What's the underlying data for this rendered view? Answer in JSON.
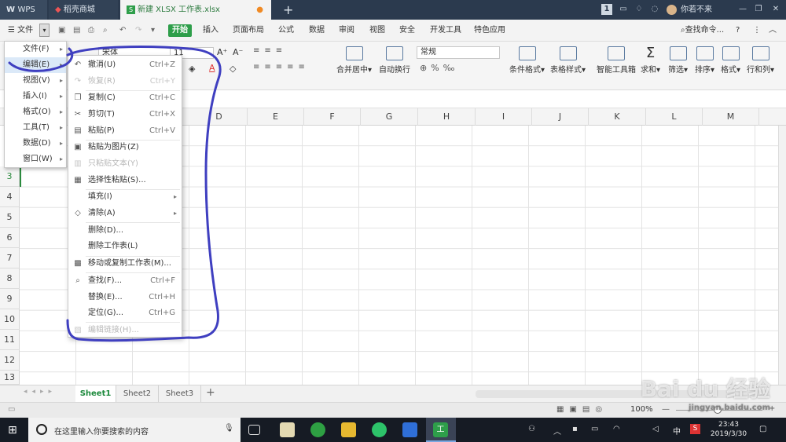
{
  "titlebar": {
    "wps": "WPS",
    "tab_store": "稻壳商城",
    "tab_file": "新建 XLSX 工作表.xlsx",
    "page_badge": "1",
    "user": "你若不来"
  },
  "menubar": {
    "file": "文件",
    "start": "开始",
    "tabs": [
      "插入",
      "页面布局",
      "公式",
      "数据",
      "审阅",
      "视图",
      "安全",
      "开发工具",
      "特色应用"
    ],
    "search": "查找命令..."
  },
  "ribbon": {
    "font_name": "宋体",
    "font_size": "11",
    "number_format": "常规",
    "merge": "合并居中",
    "wrap": "自动换行",
    "cond_format": "条件格式",
    "table_style": "表格样式",
    "smart": "智能工具箱",
    "sum": "求和",
    "filter": "筛选",
    "sort": "排序",
    "format": "格式",
    "rowcol": "行和列"
  },
  "columns": [
    "D",
    "E",
    "F",
    "G",
    "H",
    "I",
    "J",
    "K",
    "L",
    "M"
  ],
  "rows": [
    "3",
    "4",
    "5",
    "6",
    "7",
    "8",
    "9",
    "10",
    "11",
    "12",
    "13"
  ],
  "sheets": [
    "Sheet1",
    "Sheet2",
    "Sheet3"
  ],
  "status": {
    "zoom": "100%"
  },
  "file_menu": [
    {
      "label": "文件(F)",
      "arrow": true
    },
    {
      "label": "编辑(E)",
      "arrow": true,
      "highlight": true
    },
    {
      "label": "视图(V)",
      "arrow": true
    },
    {
      "label": "插入(I)",
      "arrow": true
    },
    {
      "label": "格式(O)",
      "arrow": true
    },
    {
      "label": "工具(T)",
      "arrow": true
    },
    {
      "label": "数据(D)",
      "arrow": true
    },
    {
      "label": "窗口(W)",
      "arrow": true
    }
  ],
  "edit_menu": [
    {
      "label": "撤消(U)",
      "shortcut": "Ctrl+Z",
      "icon": "undo-icon",
      "glyph": "↶",
      "disabled": false
    },
    {
      "label": "恢复(R)",
      "shortcut": "Ctrl+Y",
      "icon": "redo-icon",
      "glyph": "↷",
      "disabled": true
    },
    {
      "label": "复制(C)",
      "shortcut": "Ctrl+C",
      "icon": "copy-icon",
      "glyph": "❐",
      "disabled": false
    },
    {
      "label": "剪切(T)",
      "shortcut": "Ctrl+X",
      "icon": "cut-icon",
      "glyph": "✂",
      "disabled": false
    },
    {
      "label": "粘贴(P)",
      "shortcut": "Ctrl+V",
      "icon": "paste-icon",
      "glyph": "▤",
      "disabled": false
    },
    {
      "label": "粘贴为图片(Z)",
      "shortcut": "",
      "icon": "paste-image-icon",
      "glyph": "▣",
      "disabled": false
    },
    {
      "label": "只粘贴文本(Y)",
      "shortcut": "",
      "icon": "paste-text-icon",
      "glyph": "▥",
      "disabled": true
    },
    {
      "label": "选择性粘贴(S)...",
      "shortcut": "",
      "icon": "paste-special-icon",
      "glyph": "▦",
      "disabled": false
    },
    {
      "label": "填充(I)",
      "shortcut": "",
      "icon": "",
      "glyph": "",
      "arrow": true,
      "disabled": false
    },
    {
      "label": "清除(A)",
      "shortcut": "",
      "icon": "clear-icon",
      "glyph": "◇",
      "arrow": true,
      "disabled": false
    },
    {
      "label": "删除(D)...",
      "shortcut": "",
      "icon": "",
      "glyph": "",
      "disabled": false
    },
    {
      "label": "删除工作表(L)",
      "shortcut": "",
      "icon": "",
      "glyph": "",
      "disabled": false
    },
    {
      "label": "移动或复制工作表(M)...",
      "shortcut": "",
      "icon": "move-sheet-icon",
      "glyph": "▩",
      "disabled": false
    },
    {
      "label": "查找(F)...",
      "shortcut": "Ctrl+F",
      "icon": "find-icon",
      "glyph": "⌕",
      "disabled": false
    },
    {
      "label": "替换(E)...",
      "shortcut": "Ctrl+H",
      "icon": "",
      "glyph": "",
      "disabled": false
    },
    {
      "label": "定位(G)...",
      "shortcut": "Ctrl+G",
      "icon": "",
      "glyph": "",
      "disabled": false
    },
    {
      "label": "编辑链接(H)...",
      "shortcut": "",
      "icon": "edit-link-icon",
      "glyph": "▧",
      "disabled": true
    }
  ],
  "taskbar": {
    "search_placeholder": "在这里输入你要搜索的内容",
    "time": "23:43",
    "date": "2019/3/30",
    "ime": "中",
    "app_label": "工"
  },
  "watermark": {
    "text": "Bai du 经验",
    "url": "jingyan.baidu.com"
  },
  "colors": {
    "accent": "#2b8a3e",
    "start_button": "#2e9e4a",
    "annotation": "#3f3fc0"
  }
}
